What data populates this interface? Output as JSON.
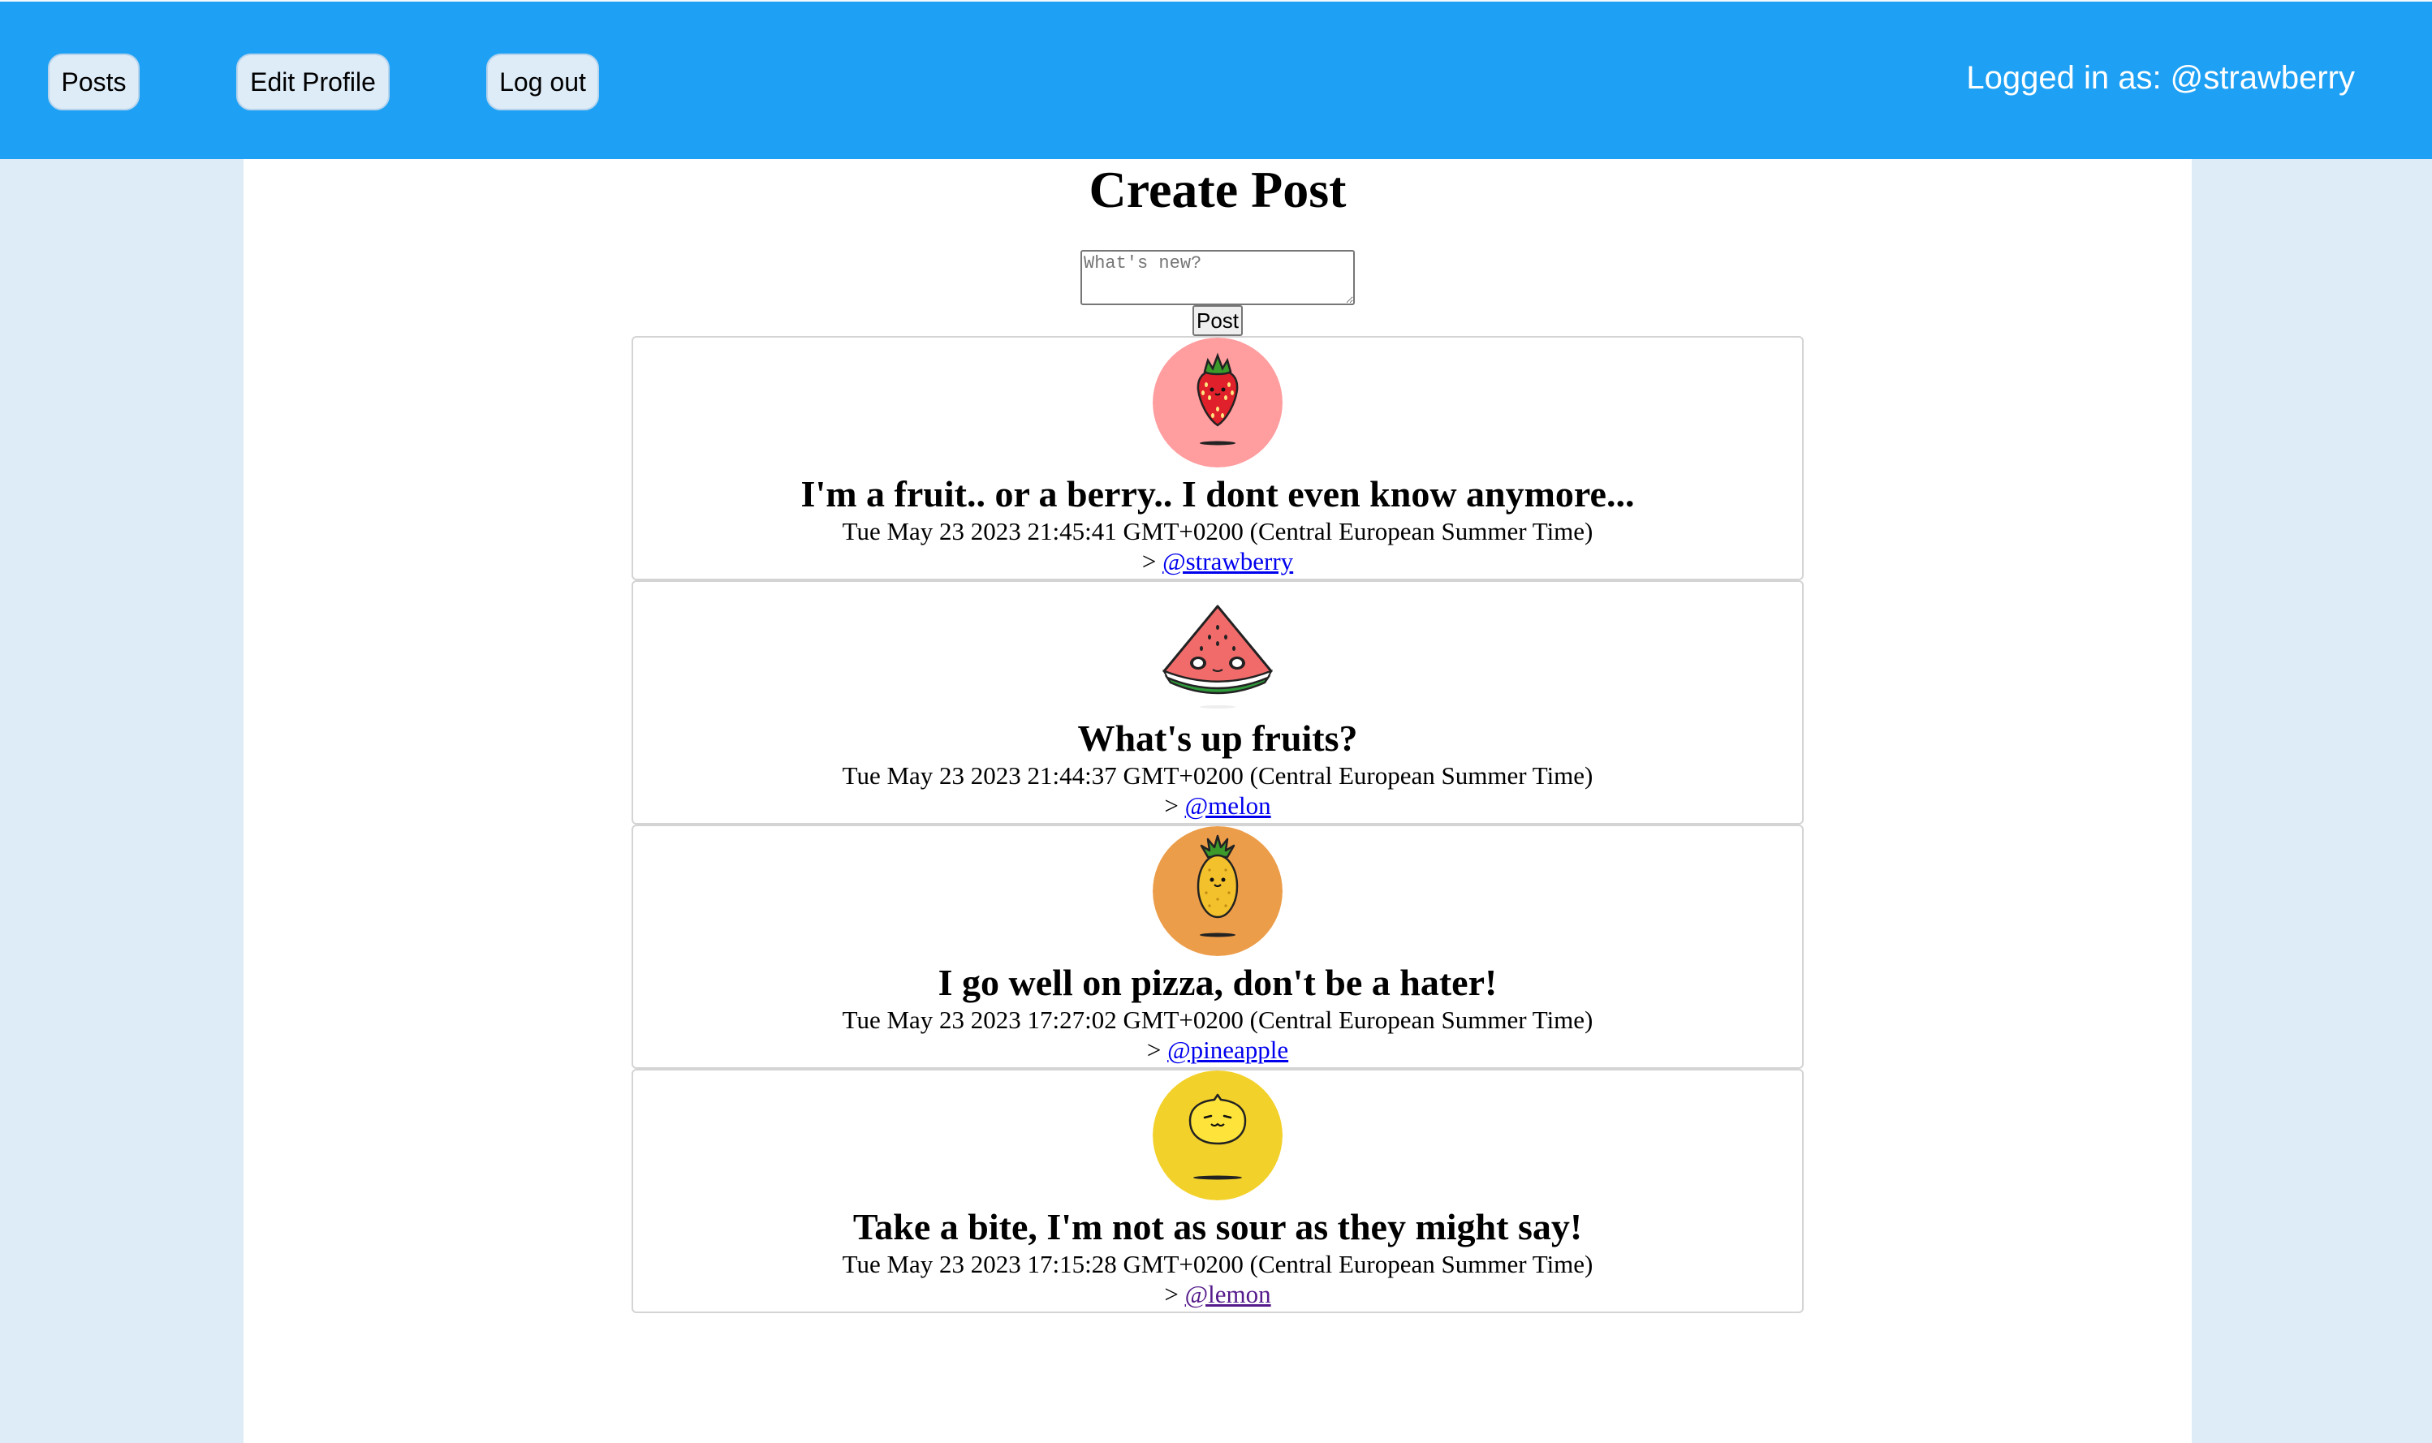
{
  "nav": {
    "posts_label": "Posts",
    "edit_profile_label": "Edit Profile",
    "logout_label": "Log out",
    "logged_in_text": "Logged in as: @strawberry"
  },
  "create": {
    "title": "Create Post",
    "placeholder": "What's new?",
    "value": "",
    "button_label": "Post"
  },
  "posts": [
    {
      "avatar": "strawberry-avatar-icon",
      "avatar_color": "#ff9d9f",
      "text": "I'm a fruit.. or a berry.. I dont even know anymore...",
      "date": "Tue May 23 2023 21:45:41 GMT+0200 (Central European Summer Time)",
      "prefix": ">",
      "author": "@strawberry"
    },
    {
      "avatar": "watermelon-avatar-icon",
      "avatar_color": "#ffffff",
      "text": "What's up fruits?",
      "date": "Tue May 23 2023 21:44:37 GMT+0200 (Central European Summer Time)",
      "prefix": ">",
      "author": "@melon"
    },
    {
      "avatar": "pineapple-avatar-icon",
      "avatar_color": "#ec9d4a",
      "text": "I go well on pizza, don't be a hater!",
      "date": "Tue May 23 2023 17:27:02 GMT+0200 (Central European Summer Time)",
      "prefix": ">",
      "author": "@pineapple"
    },
    {
      "avatar": "lemon-avatar-icon",
      "avatar_color": "#f3d12b",
      "text": "Take a bite, I'm not as sour as they might say!",
      "date": "Tue May 23 2023 17:15:28 GMT+0200 (Central European Summer Time)",
      "prefix": ">",
      "author": "@lemon"
    }
  ]
}
